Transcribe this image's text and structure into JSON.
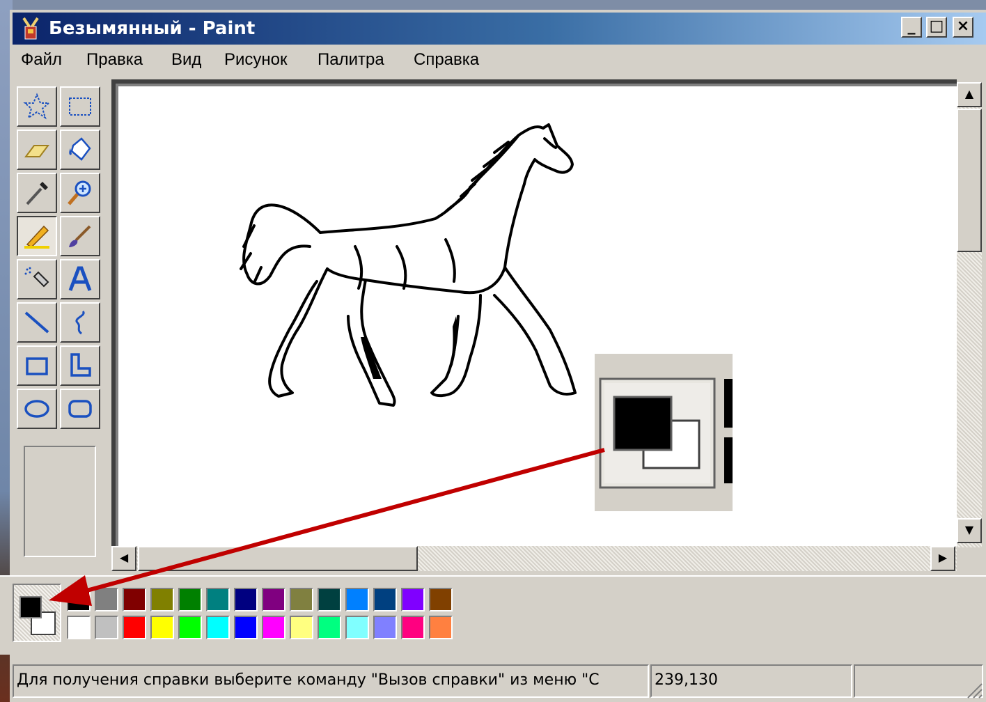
{
  "window": {
    "title": "Безымянный - Paint"
  },
  "caption_buttons": {
    "minimize": "_",
    "maximize": "□",
    "close": "×"
  },
  "menu": [
    "Файл",
    "Правка",
    "Вид",
    "Рисунок",
    "Палитра",
    "Справка"
  ],
  "tools": [
    {
      "name": "free-select",
      "icon": "star-select-icon"
    },
    {
      "name": "select",
      "icon": "rect-select-icon"
    },
    {
      "name": "eraser",
      "icon": "eraser-icon"
    },
    {
      "name": "fill",
      "icon": "paint-bucket-icon"
    },
    {
      "name": "pick-color",
      "icon": "eyedropper-icon"
    },
    {
      "name": "magnifier",
      "icon": "magnifier-icon"
    },
    {
      "name": "pencil",
      "icon": "pencil-icon",
      "active": true
    },
    {
      "name": "brush",
      "icon": "brush-icon"
    },
    {
      "name": "airbrush",
      "icon": "airbrush-icon"
    },
    {
      "name": "text",
      "icon": "text-icon"
    },
    {
      "name": "line",
      "icon": "line-icon"
    },
    {
      "name": "curve",
      "icon": "curve-icon"
    },
    {
      "name": "rectangle",
      "icon": "rectangle-icon"
    },
    {
      "name": "polygon",
      "icon": "polygon-icon"
    },
    {
      "name": "ellipse",
      "icon": "ellipse-icon"
    },
    {
      "name": "rounded-rectangle",
      "icon": "rounded-rect-icon"
    }
  ],
  "colors": {
    "foreground": "#000000",
    "background": "#ffffff",
    "palette_top": [
      "#000000",
      "#808080",
      "#800000",
      "#808000",
      "#008000",
      "#008080",
      "#000080",
      "#800080",
      "#808040",
      "#004040",
      "#0080ff",
      "#004080",
      "#8000ff",
      "#804000"
    ],
    "palette_bottom": [
      "#ffffff",
      "#c0c0c0",
      "#ff0000",
      "#ffff00",
      "#00ff00",
      "#00ffff",
      "#0000ff",
      "#ff00ff",
      "#ffff80",
      "#00ff80",
      "#80ffff",
      "#8080ff",
      "#ff0080",
      "#ff8040"
    ]
  },
  "status": {
    "help": "Для получения справки выберите команду \"Вызов справки\" из меню \"С",
    "coords": "239,130",
    "size": ""
  }
}
